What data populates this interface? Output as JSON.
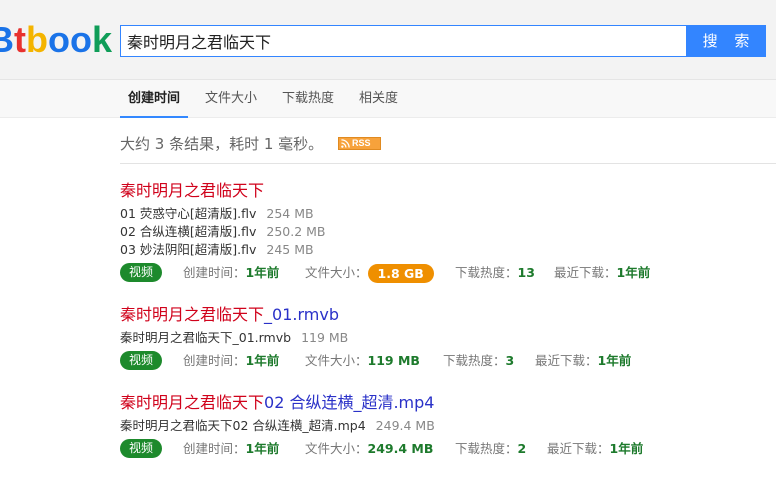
{
  "search": {
    "logo_text": "Btbook",
    "query": "秦时明月之君临天下",
    "button_label": "搜 索"
  },
  "tabs": [
    {
      "label": "创建时间",
      "active": true
    },
    {
      "label": "文件大小",
      "active": false
    },
    {
      "label": "下载热度",
      "active": false
    },
    {
      "label": "相关度",
      "active": false
    }
  ],
  "summary": {
    "text": "大约 3 条结果，耗时 1 毫秒。",
    "rss_label": "RSS"
  },
  "meta_labels": {
    "created": "创建时间：",
    "size": "文件大小：",
    "hotness": "下载热度：",
    "last_download": "最近下载："
  },
  "results": [
    {
      "title_highlight": "秦时明月之君临天下",
      "title_rest": "",
      "files": [
        {
          "name": "01 荧惑守心[超清版].flv",
          "size": "254 MB"
        },
        {
          "name": "02 合纵连横[超清版].flv",
          "size": "250.2 MB"
        },
        {
          "name": "03 妙法阴阳[超清版].flv",
          "size": "245 MB"
        }
      ],
      "badge": "视频",
      "created": "1年前",
      "size": "1.8 GB",
      "size_highlighted": true,
      "hotness": "13",
      "last_download": "1年前"
    },
    {
      "title_highlight": "秦时明月之君临天下",
      "title_rest": "_01.rmvb",
      "files": [
        {
          "name": "秦时明月之君临天下_01.rmvb",
          "size": "119 MB"
        }
      ],
      "badge": "视频",
      "created": "1年前",
      "size": "119 MB",
      "size_highlighted": false,
      "hotness": "3",
      "last_download": "1年前"
    },
    {
      "title_highlight": "秦时明月之君临天下",
      "title_rest": "02 合纵连横_超清.mp4",
      "files": [
        {
          "name": "秦时明月之君临天下02 合纵连横_超清.mp4",
          "size": "249.4 MB"
        }
      ],
      "badge": "视频",
      "created": "1年前",
      "size": "249.4 MB",
      "size_highlighted": false,
      "hotness": "2",
      "last_download": "1年前"
    }
  ],
  "colors": {
    "accent": "#3385ff",
    "highlight": "#d0021b",
    "link": "#2a31c8",
    "badge": "#1d8a2c",
    "size_pill": "#ef8f00"
  }
}
